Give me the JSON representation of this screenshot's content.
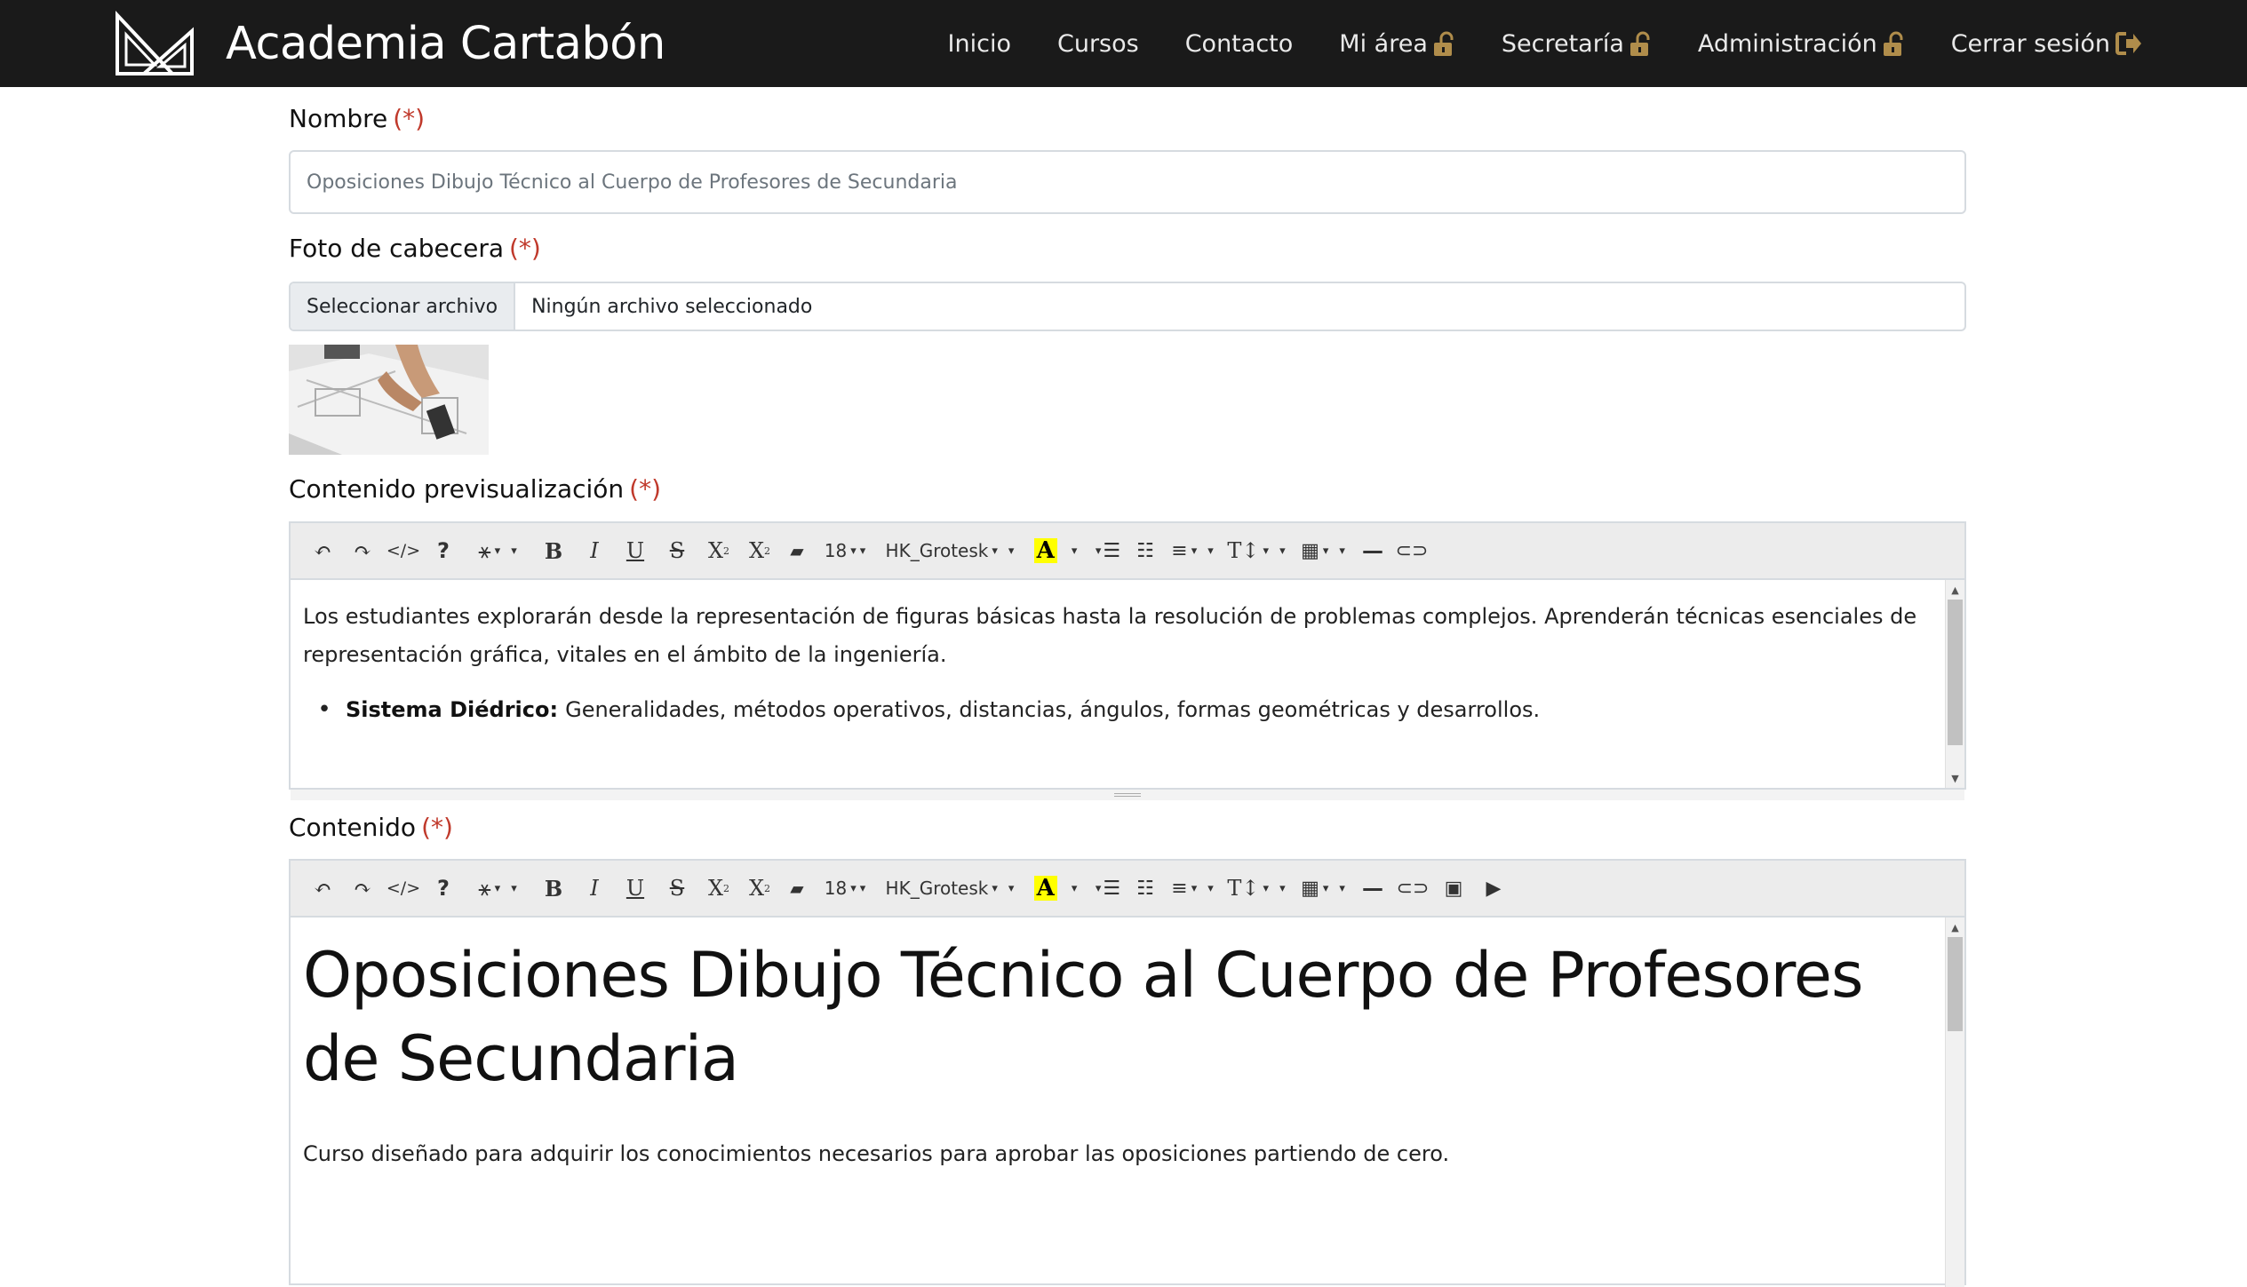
{
  "navbar": {
    "brand": "Academia Cartabón",
    "items": [
      {
        "label": "Inicio",
        "icon": ""
      },
      {
        "label": "Cursos",
        "icon": ""
      },
      {
        "label": "Contacto",
        "icon": ""
      },
      {
        "label": "Mi área",
        "icon": "unlock-icon"
      },
      {
        "label": "Secretaría",
        "icon": "unlock-icon"
      },
      {
        "label": "Administración",
        "icon": "unlock-icon"
      },
      {
        "label": "Cerrar sesión",
        "icon": "sign-out-icon"
      }
    ],
    "icon_color": "#b08d4b"
  },
  "form": {
    "nombre": {
      "label": "Nombre",
      "required": "(*)",
      "value": "Oposiciones Dibujo Técnico al Cuerpo de Profesores de Secundaria"
    },
    "foto": {
      "label": "Foto de cabecera",
      "required": "(*)",
      "button": "Seleccionar archivo",
      "file_status": "Ningún archivo seleccionado"
    },
    "preview": {
      "label": "Contenido previsualización",
      "required": "(*)",
      "toolbar": {
        "font_size": "18",
        "font_name": "HK_Grotesk"
      },
      "paragraph": "Los estudiantes explorarán desde la representación de figuras básicas hasta la resolución de problemas complejos. Aprenderán técnicas esenciales de representación gráfica, vitales en el ámbito de la ingeniería.",
      "bullet_title": "Sistema Diédrico:",
      "bullet_text": "Generalidades, métodos operativos, distancias, ángulos, formas geométricas y desarrollos."
    },
    "contenido": {
      "label": "Contenido",
      "required": "(*)",
      "toolbar": {
        "font_size": "18",
        "font_name": "HK_Grotesk"
      },
      "heading": "Oposiciones Dibujo Técnico al Cuerpo de Profesores de Secundaria",
      "paragraph": "Curso diseñado para adquirir los conocimientos necesarios para aprobar las oposiciones partiendo de cero."
    }
  },
  "colors": {
    "navbar_bg": "#1a1a1a",
    "required": "#c0392b",
    "highlight": "#ffff00"
  }
}
